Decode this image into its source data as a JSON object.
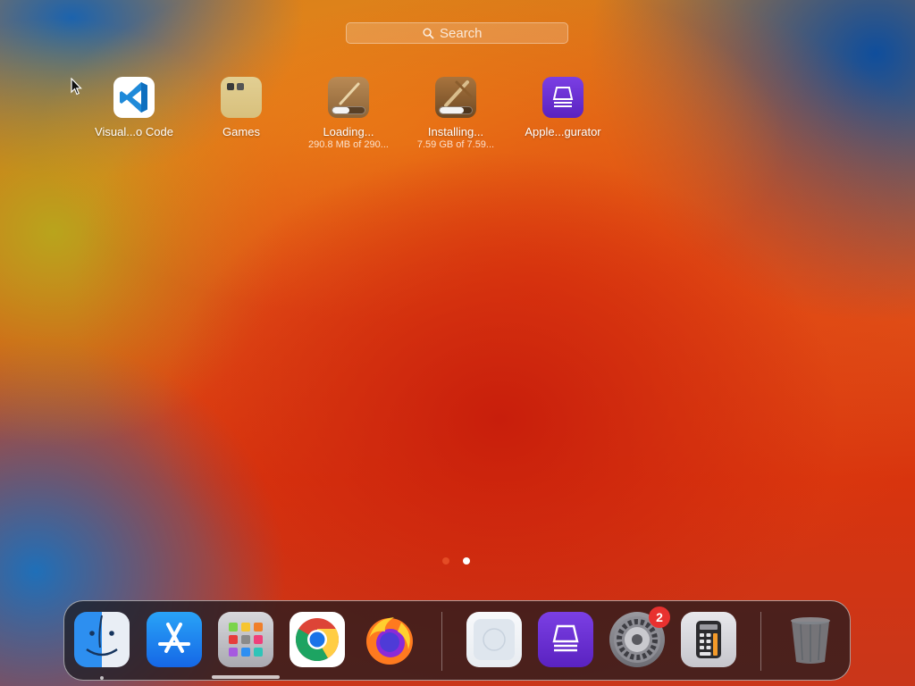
{
  "search": {
    "placeholder": "Search"
  },
  "apps": [
    {
      "id": "vscode",
      "name": "Visual...o Code",
      "sub": ""
    },
    {
      "id": "games",
      "name": "Games",
      "sub": ""
    },
    {
      "id": "loading",
      "name": "Loading...",
      "sub": "290.8 MB of 290...",
      "progress": 0.52
    },
    {
      "id": "installing",
      "name": "Installing...",
      "sub": "7.59 GB of 7.59...",
      "progress": 0.75
    },
    {
      "id": "apple-configurator",
      "name": "Apple...gurator",
      "sub": ""
    }
  ],
  "page_indicator": {
    "count": 2,
    "current": 2
  },
  "dock": {
    "items": [
      {
        "name": "finder",
        "icon": "finder-icon",
        "running": true
      },
      {
        "name": "app-store",
        "icon": "app-store-icon"
      },
      {
        "name": "launchpad",
        "icon": "launchpad-icon"
      },
      {
        "name": "chrome",
        "icon": "chrome-icon"
      },
      {
        "name": "firefox",
        "icon": "firefox-icon"
      },
      {
        "name": "preview",
        "icon": "blank-app-icon"
      },
      {
        "name": "apple-configurator",
        "icon": "configurator-icon"
      },
      {
        "name": "system-settings",
        "icon": "gear-icon",
        "badge": "2"
      },
      {
        "name": "calculator",
        "icon": "calculator-icon"
      },
      {
        "name": "trash",
        "icon": "trash-icon"
      }
    ]
  },
  "colors": {
    "configurator_purple": "#6a2fd1",
    "vscode_blue": "#1f8ad9",
    "badge_red": "#e8312f"
  }
}
